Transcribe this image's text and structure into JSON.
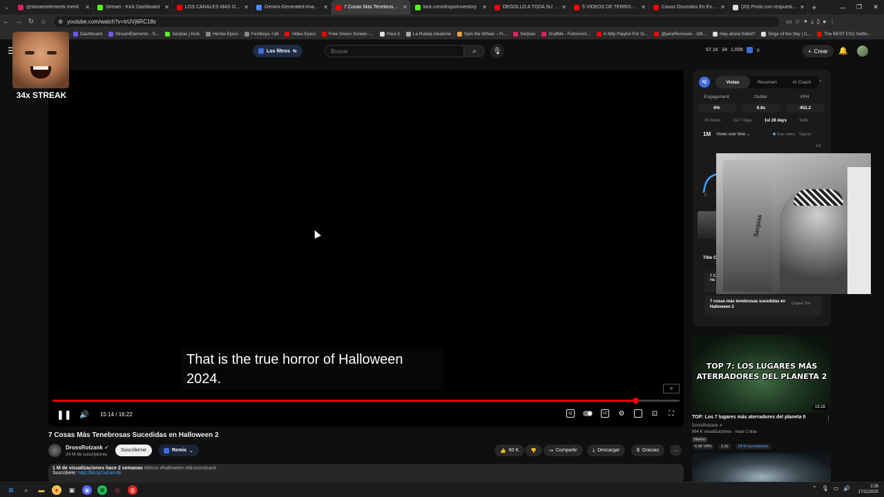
{
  "browser": {
    "tabs": [
      {
        "title": "@streamelements menti",
        "favicon_color": "#e61f5b",
        "active": false
      },
      {
        "title": "Stream - Kick Dashboard",
        "favicon_color": "#53fc18",
        "active": false
      },
      {
        "title": "LOS CANALES MÁS OSCURO",
        "favicon_color": "#ff0000",
        "active": false
      },
      {
        "title": "Gemini-Generated-Image-h",
        "favicon_color": "#4c8bf5",
        "active": false
      },
      {
        "title": "7 Cosas Más Tenebrosas S",
        "favicon_color": "#ff0000",
        "active": true
      },
      {
        "title": "kick.com/drops/inventory",
        "favicon_color": "#53fc18",
        "active": false
      },
      {
        "title": "DEGOLLÓ A TODA SU FAMILI",
        "favicon_color": "#ff0000",
        "active": false
      },
      {
        "title": "5 VIDEOS DE TERROR que N",
        "favicon_color": "#ff0000",
        "active": false
      },
      {
        "title": "Casos Ocurridos En Exploració",
        "favicon_color": "#ff0000",
        "active": false
      },
      {
        "title": "(20) Posts con respuestas de",
        "favicon_color": "#dddddd",
        "active": false
      }
    ],
    "url": "youtube.com/watch?v=trUVj6RC18s",
    "bookmarks": [
      {
        "label": "Dashboard",
        "color": "#6b5bff"
      },
      {
        "label": "StreamElements - S...",
        "color": "#6b5bff"
      },
      {
        "label": "Serpias | Kick",
        "color": "#53fc18"
      },
      {
        "label": "Hentai Epico",
        "color": "#888888"
      },
      {
        "label": "Femboys +18",
        "color": "#888888"
      },
      {
        "label": "Video Epico",
        "color": "#ff0000"
      },
      {
        "label": "Free Green Screen -...",
        "color": "#ff0000"
      },
      {
        "label": "Para ti",
        "color": "#dddddd"
      },
      {
        "label": "La Ruleta Aleatoria",
        "color": "#aaaaaa"
      },
      {
        "label": "Spin the Wheel – Fr...",
        "color": "#e9a23b"
      },
      {
        "label": "Serpias",
        "color": "#e61f5b"
      },
      {
        "label": "GrafMe - Fotomont...",
        "color": "#e61f5b"
      },
      {
        "label": "A Silly Playlist For Si...",
        "color": "#ff0000"
      },
      {
        "label": "@janeRemover - OB...",
        "color": "#ff0000"
      },
      {
        "label": "Hay ahora fútbol?",
        "color": "#dddddd"
      },
      {
        "label": "Dirge of the Sky | C...",
        "color": "#dddddd"
      },
      {
        "label": "The BEST CS2 Settin...",
        "color": "#ff0000"
      }
    ]
  },
  "header": {
    "filters_label": "Los filtros",
    "search_placeholder": "Buscar",
    "ext_stats": [
      "57.1K",
      "34",
      "1,009"
    ],
    "create_label": "Crear"
  },
  "streak": {
    "label": "34x STREAK"
  },
  "player": {
    "subtitle": "That is the true horror of Halloween 2024.",
    "current_time": "15:14",
    "duration": "16:22",
    "time_display": "15:14 / 16:22",
    "progress_fraction": 0.93
  },
  "video": {
    "title": "7 Cosas Más Tenebrosas Sucedidas en Halloween 2",
    "channel": "DrossRotzank",
    "subscribers": "24 M de suscriptores",
    "subscribe_label": "Suscribirme",
    "remix_label": "Remix",
    "likes": "60 K",
    "share_label": "Compartir",
    "download_label": "Descargar",
    "thanks_label": "Gracias",
    "description_meta": "1 M de visualizaciones  hace 2 semanas",
    "hashtags": "#dross #halloween #drossrotzank",
    "subscribe_line_label": "Suscribete:",
    "subscribe_link": "http://bit.ly/1a1am3k"
  },
  "extension": {
    "logo": "iQ",
    "tabs": [
      "Vistas",
      "Resumen",
      "AI Coach"
    ],
    "metrics": [
      {
        "label": "Engagement",
        "value": "6%"
      },
      {
        "label": "Outlier",
        "value": "0.8x"
      },
      {
        "label": "VPH",
        "value": "452.2"
      }
    ],
    "periods": [
      "24 hours",
      "1st 7 days",
      "1st 28 days",
      "Todo"
    ],
    "active_period": "1st 28 days",
    "views_big": "1M",
    "views_select": "Views over time",
    "legend": [
      "Este video",
      "Typical"
    ],
    "y_top": "1M",
    "y_zero": "0",
    "title_section": "Title C",
    "title_card_a": "7 C\nHa",
    "title_card_b_title": "7 cosas más tenebrosas sucedidas en Halloween 2",
    "title_card_b_tag": "Original Title",
    "webcam_brand": "Serpias"
  },
  "recommendation": {
    "thumb_text": "TOP 7: LOS LUGARES MÁS ATERRADORES DEL PLANETA 2",
    "duration": "15:28",
    "title": "TOP: Los 7 lugares más aterradores del planeta II",
    "channel": "DrossRotzank",
    "meta": "864 K visualizaciones · hace 2 días",
    "badge": "Nuevo",
    "stats": [
      "6.0K VPH",
      "1.2x",
      "24 M suscriptores"
    ]
  },
  "taskbar": {
    "time": "2:26",
    "date": "17/11/2025"
  }
}
